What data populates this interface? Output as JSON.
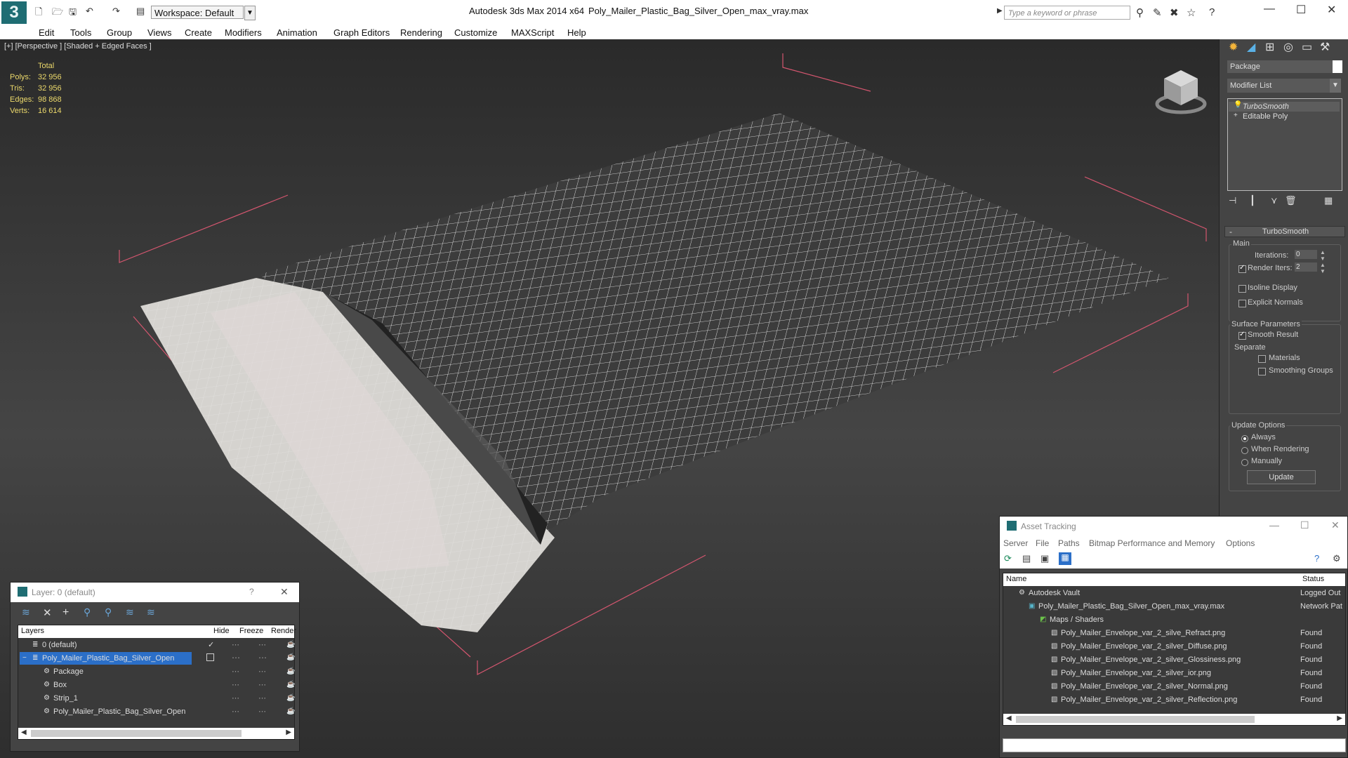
{
  "titlebar": {
    "workspace": "Workspace: Default",
    "app_title": "Autodesk 3ds Max  2014 x64",
    "file_title": "Poly_Mailer_Plastic_Bag_Silver_Open_max_vray.max",
    "search_placeholder": "Type a keyword or phrase"
  },
  "menu": [
    "Edit",
    "Tools",
    "Group",
    "Views",
    "Create",
    "Modifiers",
    "Animation",
    "Graph Editors",
    "Rendering",
    "Customize",
    "MAXScript",
    "Help"
  ],
  "viewport": {
    "label": "[+] [Perspective ] [Shaded + Edged Faces ]",
    "stats_header": "Total",
    "stats": [
      {
        "k": "Polys:",
        "v": "32 956"
      },
      {
        "k": "Tris:",
        "v": "32 956"
      },
      {
        "k": "Edges:",
        "v": "98 868"
      },
      {
        "k": "Verts:",
        "v": "16 614"
      }
    ]
  },
  "command_panel": {
    "object_name": "Package",
    "modifier_list": "Modifier List",
    "stack": [
      "TurboSmooth",
      "Editable Poly"
    ],
    "rollout_title": "TurboSmooth",
    "main_label": "Main",
    "iterations_label": "Iterations:",
    "iterations_value": "0",
    "render_iters_label": "Render Iters:",
    "render_iters_value": "2",
    "isoline_label": "Isoline Display",
    "explicit_normals_label": "Explicit Normals",
    "surface_params_label": "Surface Parameters",
    "smooth_result_label": "Smooth Result",
    "separate_label": "Separate",
    "materials_label": "Materials",
    "smoothing_groups_label": "Smoothing Groups",
    "update_options_label": "Update Options",
    "always_label": "Always",
    "when_rendering_label": "When Rendering",
    "manually_label": "Manually",
    "update_button": "Update"
  },
  "layer_panel": {
    "title": "Layer: 0 (default)",
    "help": "?",
    "close": "✕",
    "columns": [
      "Layers",
      "Hide",
      "Freeze",
      "Render"
    ],
    "rows": [
      {
        "name": "0 (default)",
        "indent": 1,
        "selected": false
      },
      {
        "name": "Poly_Mailer_Plastic_Bag_Silver_Open",
        "indent": 1,
        "selected": true
      },
      {
        "name": "Package",
        "indent": 2,
        "selected": false
      },
      {
        "name": "Box",
        "indent": 2,
        "selected": false
      },
      {
        "name": "Strip_1",
        "indent": 2,
        "selected": false
      },
      {
        "name": "Poly_Mailer_Plastic_Bag_Silver_Open",
        "indent": 2,
        "selected": false
      }
    ]
  },
  "asset_panel": {
    "title": "Asset Tracking",
    "menu": [
      "Server",
      "File",
      "Paths",
      "Bitmap Performance and Memory",
      "Options"
    ],
    "columns": [
      "Name",
      "Status"
    ],
    "rows": [
      {
        "name": "Autodesk Vault",
        "status": "Logged Out",
        "indent": 1
      },
      {
        "name": "Poly_Mailer_Plastic_Bag_Silver_Open_max_vray.max",
        "status": "Network Pat",
        "indent": 2
      },
      {
        "name": "Maps / Shaders",
        "status": "",
        "indent": 3
      },
      {
        "name": "Poly_Mailer_Envelope_var_2_silve_Refract.png",
        "status": "Found",
        "indent": 4
      },
      {
        "name": "Poly_Mailer_Envelope_var_2_silver_Diffuse.png",
        "status": "Found",
        "indent": 4
      },
      {
        "name": "Poly_Mailer_Envelope_var_2_silver_Glossiness.png",
        "status": "Found",
        "indent": 4
      },
      {
        "name": "Poly_Mailer_Envelope_var_2_silver_ior.png",
        "status": "Found",
        "indent": 4
      },
      {
        "name": "Poly_Mailer_Envelope_var_2_silver_Normal.png",
        "status": "Found",
        "indent": 4
      },
      {
        "name": "Poly_Mailer_Envelope_var_2_silver_Reflection.png",
        "status": "Found",
        "indent": 4
      }
    ]
  }
}
